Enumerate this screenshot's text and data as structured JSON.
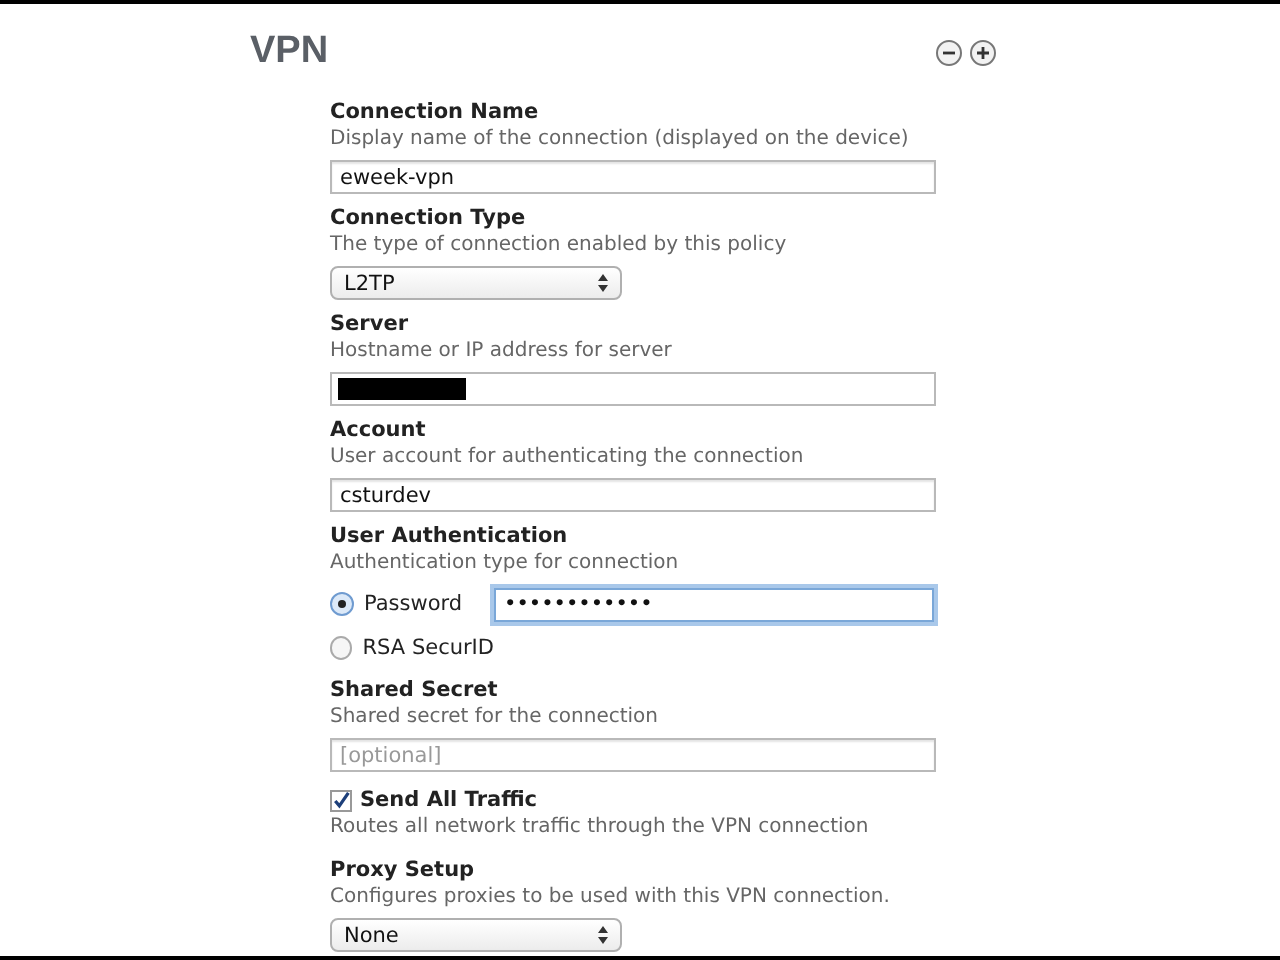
{
  "header": {
    "title": "VPN"
  },
  "fields": [
    {
      "kind": "text",
      "label": "Connection Name",
      "description": "Display name of the connection (displayed on the device)",
      "value": "eweek-vpn"
    },
    {
      "kind": "select",
      "label": "Connection Type",
      "description": "The type of connection enabled by this policy",
      "value": "L2TP"
    },
    {
      "kind": "redacted",
      "label": "Server",
      "description": "Hostname or IP address for server"
    },
    {
      "kind": "text",
      "label": "Account",
      "description": "User account for authenticating the connection",
      "value": "csturdev"
    },
    {
      "kind": "radio",
      "label": "User Authentication",
      "description": "Authentication type for connection",
      "options": [
        {
          "label": "Password",
          "selected": true
        },
        {
          "label": "RSA SecurID",
          "selected": false
        }
      ],
      "password": {
        "value": "••••••••••••",
        "focused": true
      }
    },
    {
      "kind": "text",
      "label": "Shared Secret",
      "description": "Shared secret for the connection",
      "placeholder": "[optional]"
    },
    {
      "kind": "checkbox",
      "label": "Send All Traffic",
      "checked": true,
      "description": "Routes all network traffic through the VPN connection"
    },
    {
      "kind": "select",
      "label": "Proxy Setup",
      "description": "Configures proxies to be used with this VPN connection.",
      "value": "None"
    }
  ]
}
